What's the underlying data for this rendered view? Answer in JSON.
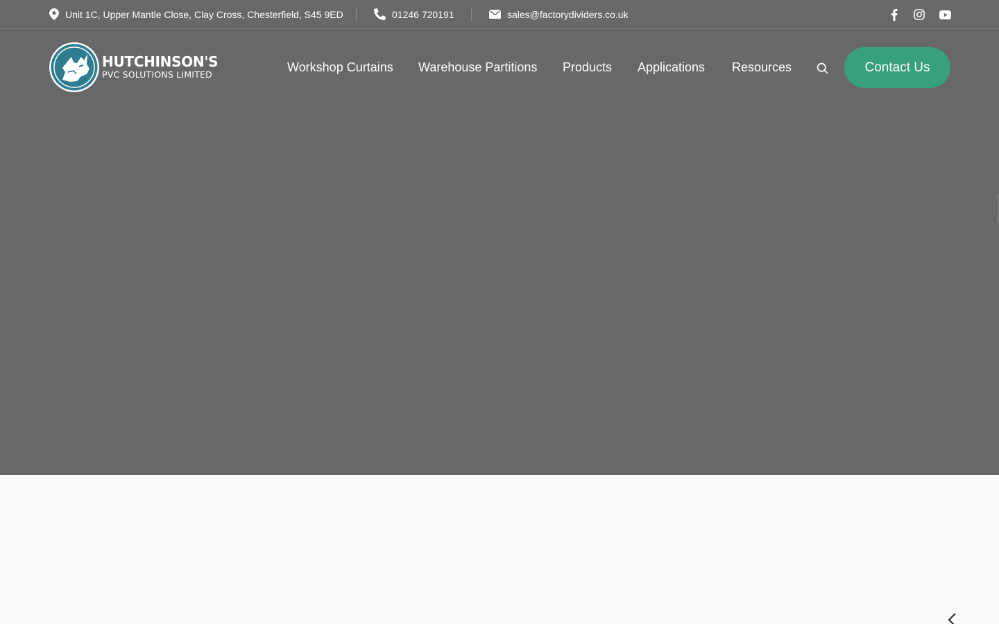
{
  "topbar": {
    "address": "Unit 1C, Upper Mantle Close, Clay Cross, Chesterfield, S45 9ED",
    "phone": "01246 720191",
    "email": "sales@factorydividers.co.uk",
    "social": [
      "facebook-icon",
      "instagram-icon",
      "youtube-icon"
    ]
  },
  "logo": {
    "title": "HUTCHINSON'S",
    "subtitle": "PVC SOLUTIONS LIMITED"
  },
  "nav": {
    "items": [
      "Workshop Curtains",
      "Warehouse Partitions",
      "Products",
      "Applications",
      "Resources"
    ],
    "contact_label": "Contact Us"
  },
  "colors": {
    "hero_overlay": "#67686a",
    "accent": "#38a07a",
    "logo_teal": "#2e7d91",
    "page_background": "#fafafa"
  }
}
